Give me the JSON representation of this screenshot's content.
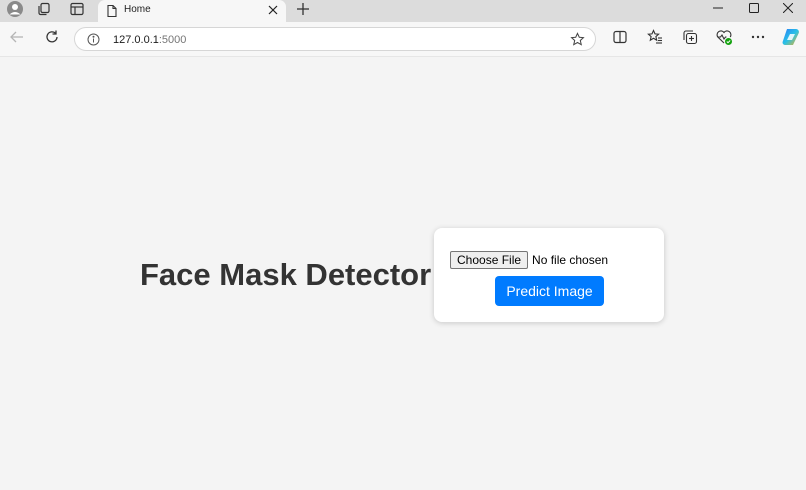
{
  "browser": {
    "tab_title": "Home",
    "address_host": "127.0.0.1",
    "address_port": ":5000",
    "icons": {
      "profile": "profile-icon",
      "workspaces": "workspaces-icon",
      "tab_actions": "tab-actions-icon",
      "page": "page-icon",
      "close_tab": "close-icon",
      "new_tab": "plus-icon",
      "minimize": "minimize-icon",
      "maximize": "maximize-icon",
      "close_window": "close-icon",
      "back": "back-arrow-icon",
      "refresh": "refresh-icon",
      "site_info": "info-icon",
      "favorite": "star-icon",
      "split_screen": "split-screen-icon",
      "favorites": "favorites-icon",
      "collections": "collections-icon",
      "browser_essentials": "heart-pulse-icon",
      "more": "more-icon",
      "copilot": "copilot-icon"
    }
  },
  "page": {
    "heading": "Face Mask Detector",
    "choose_file_label": "Choose File",
    "file_status": "No file chosen",
    "predict_label": "Predict Image"
  },
  "colors": {
    "primary_button": "#007bff",
    "heading_text": "#333333",
    "page_background": "#f4f4f4"
  }
}
